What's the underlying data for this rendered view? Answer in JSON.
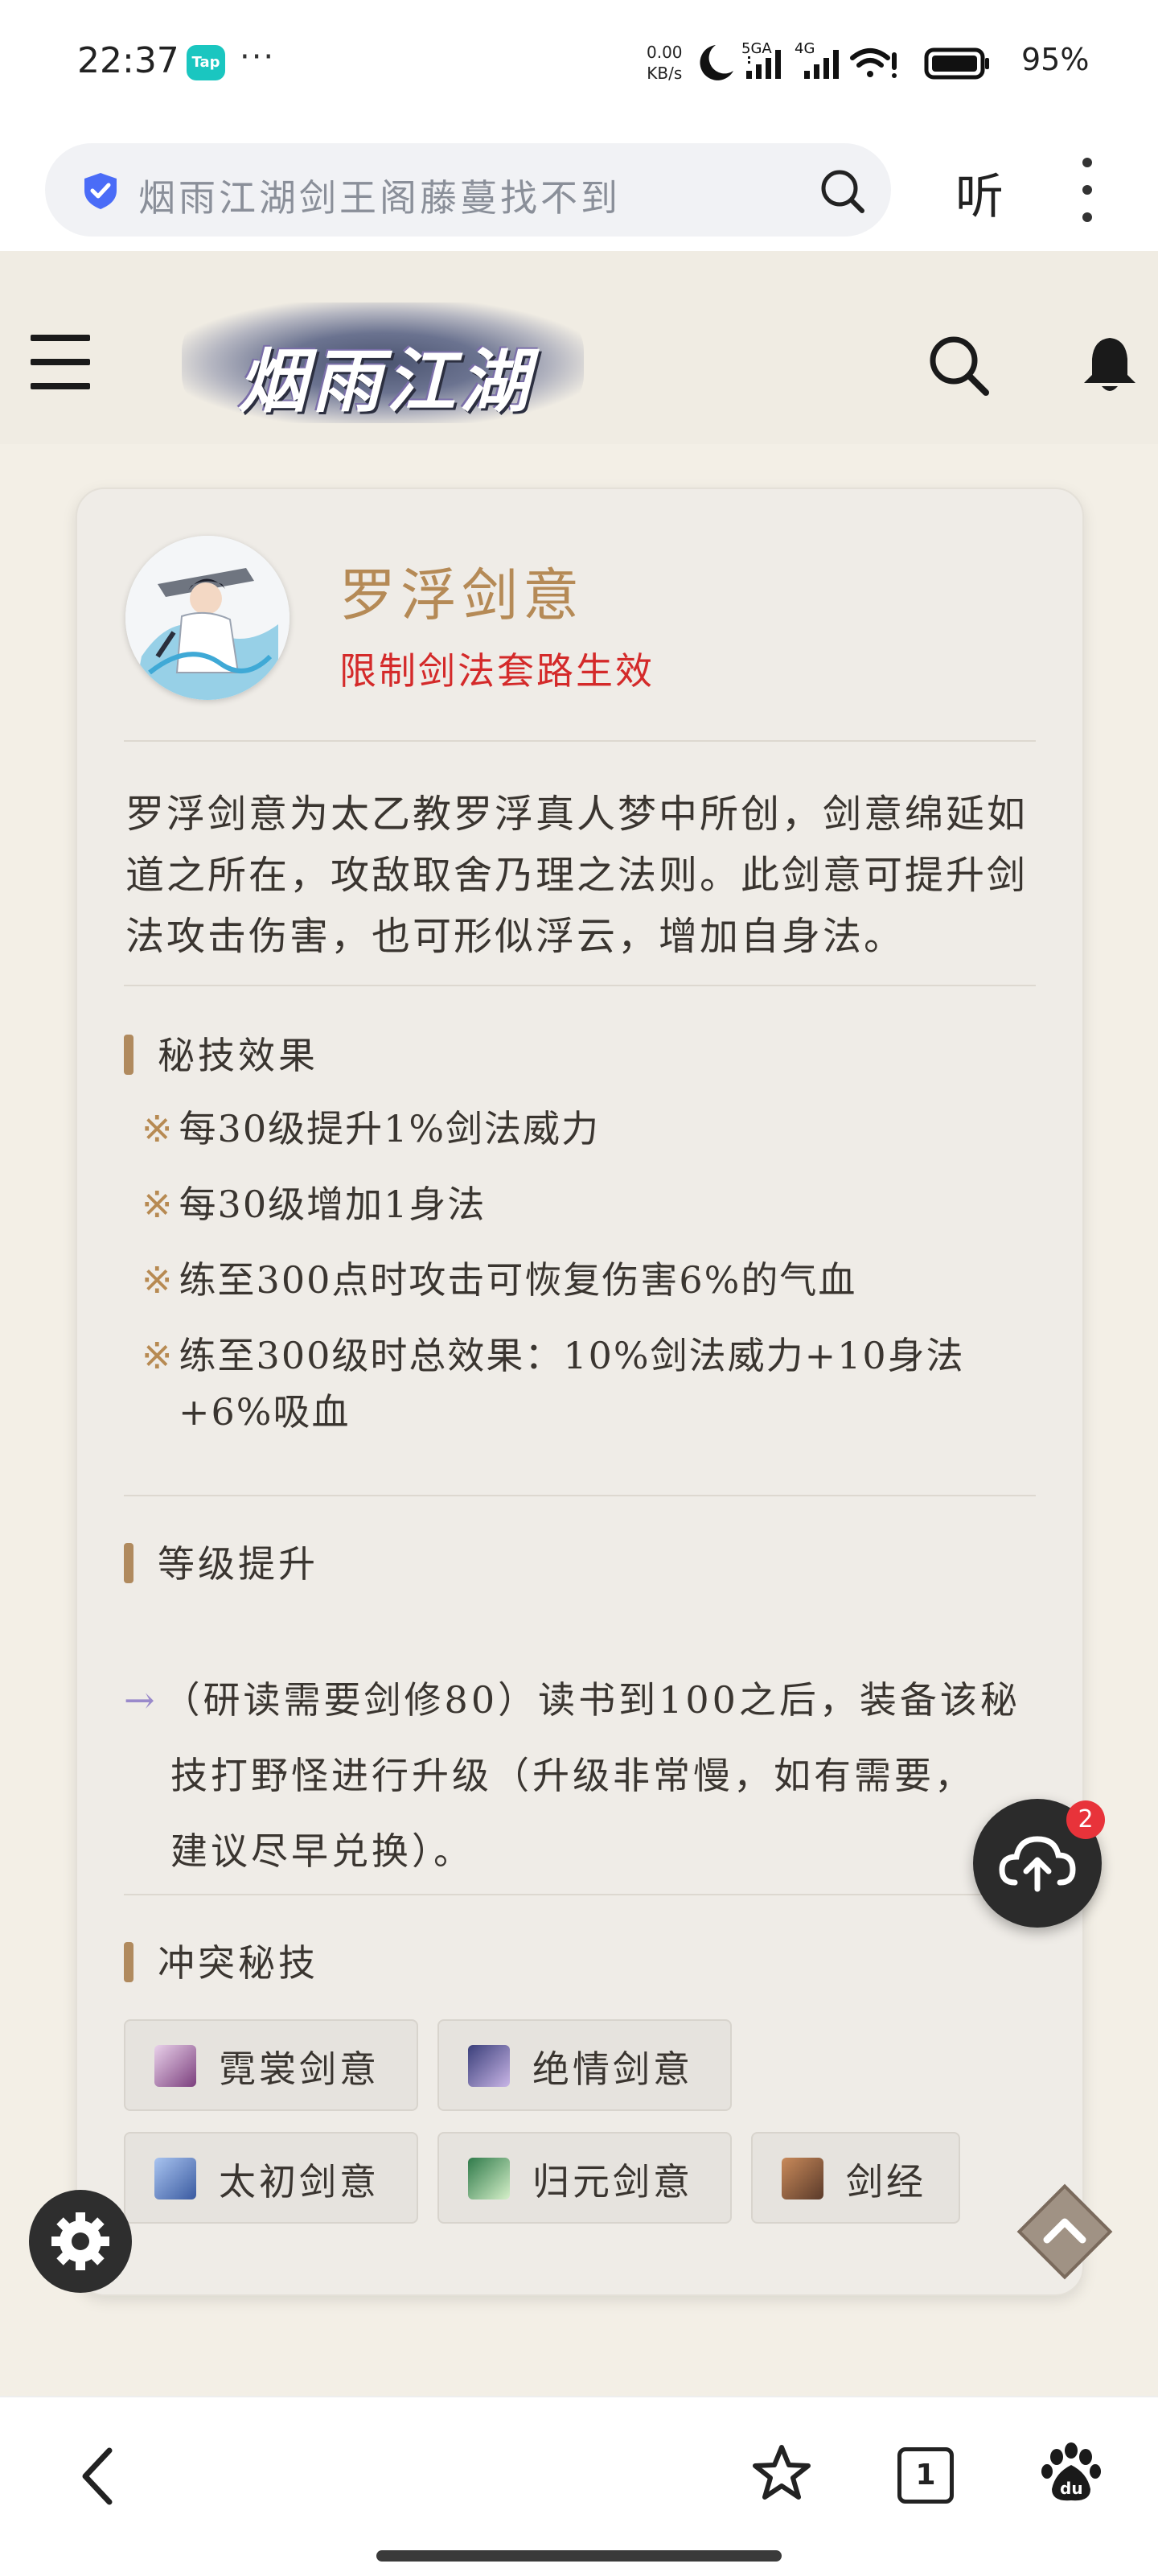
{
  "status_bar": {
    "time": "22:37",
    "tap_badge": "Tap",
    "more": "···",
    "speed_value": "0.00",
    "speed_unit": "KB/s",
    "network_5g": "5GA",
    "network_4g": "4G",
    "battery": "95%"
  },
  "browser": {
    "url_text": "烟雨江湖剑王阁藤蔓找不到",
    "listen_label": "听"
  },
  "site": {
    "logo_text": "烟雨江湖"
  },
  "skill": {
    "title": "罗浮剑意",
    "subtitle": "限制剑法套路生效",
    "description": "罗浮剑意为太乙教罗浮真人梦中所创，剑意绵延如道之所在，攻敌取舍乃理之法则。此剑意可提升剑法攻击伤害，也可形似浮云，增加自身法。"
  },
  "effects_section": {
    "heading": "秘技效果",
    "mark": "※",
    "items": [
      "每30级提升1%剑法威力",
      "每30级增加1身法",
      "练至300点时攻击可恢复伤害6%的气血",
      "练至300级时总效果：10%剑法威力+10身法"
    ],
    "item4_cont": "+6%吸血"
  },
  "upgrade_section": {
    "heading": "等级提升",
    "arrow": "→",
    "line1": "（研读需要剑修80）读书到100之后，装备该秘",
    "line2": "技打野怪进行升级（升级非常慢，如有需要，",
    "line3": "建议尽早兑换）。"
  },
  "conflict_section": {
    "heading": "冲突秘技",
    "chips": [
      "霓裳剑意",
      "绝情剑意",
      "太初剑意",
      "归元剑意",
      "剑经"
    ]
  },
  "floating": {
    "upload_badge": "2"
  },
  "bottom_nav": {
    "tab_count": "1"
  },
  "colors": {
    "title_gold": "#b58a56",
    "subtitle_red": "#d42a2a",
    "section_bar": "#b08a5e",
    "page_bg": "#f3efe6"
  }
}
